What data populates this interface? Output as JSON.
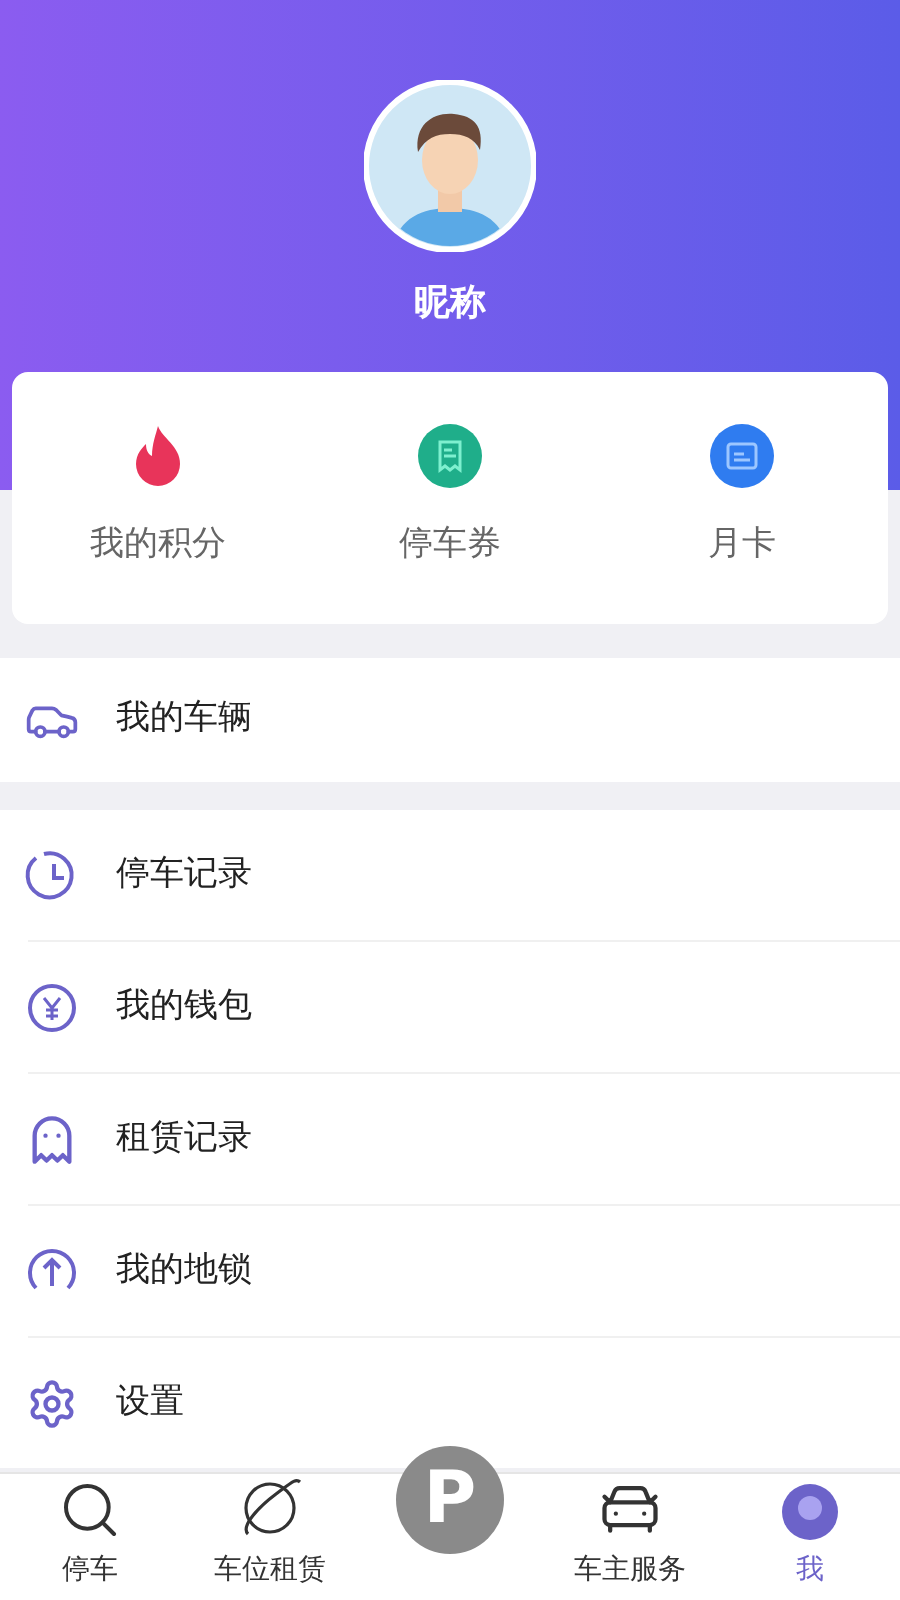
{
  "profile": {
    "nickname": "昵称"
  },
  "quick_actions": [
    {
      "label": "我的积分"
    },
    {
      "label": "停车券"
    },
    {
      "label": "月卡"
    }
  ],
  "menu_groups": [
    [
      {
        "label": "我的车辆"
      }
    ],
    [
      {
        "label": "停车记录"
      },
      {
        "label": "我的钱包"
      },
      {
        "label": "租赁记录"
      },
      {
        "label": "我的地锁"
      },
      {
        "label": "设置"
      }
    ]
  ],
  "bottom_nav": [
    {
      "kind": "tab",
      "label": "停车",
      "selected": false
    },
    {
      "kind": "tab",
      "label": "车位租赁",
      "selected": false
    },
    {
      "kind": "center",
      "label": "P"
    },
    {
      "kind": "tab",
      "label": "车主服务",
      "selected": false
    },
    {
      "kind": "tab",
      "label": "我",
      "selected": true
    }
  ]
}
